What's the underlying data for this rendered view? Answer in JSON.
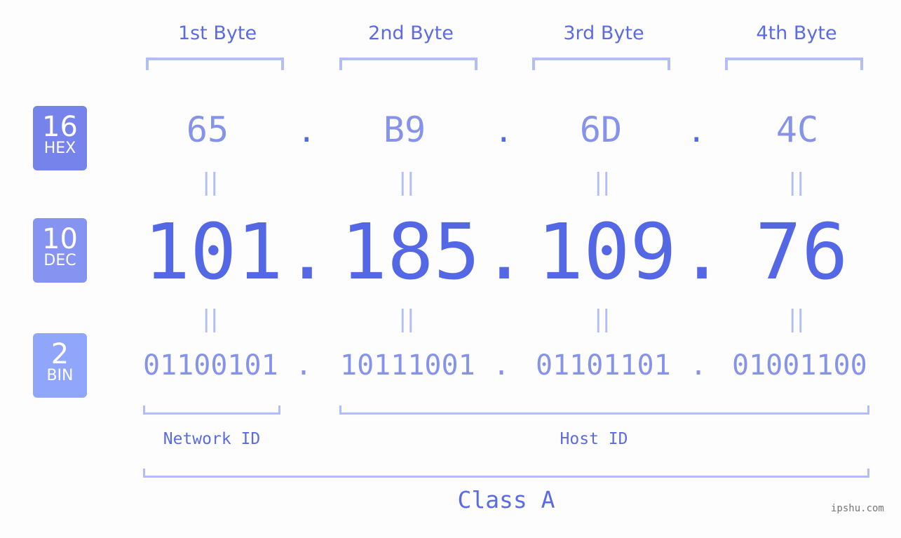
{
  "byte_headers": [
    "1st Byte",
    "2nd Byte",
    "3rd Byte",
    "4th Byte"
  ],
  "badges": {
    "hex": {
      "base": "16",
      "label": "HEX",
      "color": "#7683ea"
    },
    "dec": {
      "base": "10",
      "label": "DEC",
      "color": "#8693f0"
    },
    "bin": {
      "base": "2",
      "label": "BIN",
      "color": "#8fa6fa"
    }
  },
  "hex_values": [
    "65",
    "B9",
    "6D",
    "4C"
  ],
  "dec_values": [
    "101",
    "185",
    "109",
    "76"
  ],
  "bin_values": [
    "01100101",
    "10111001",
    "01101101",
    "01001100"
  ],
  "separator": ".",
  "equals_glyph": "||",
  "network_id_label": "Network ID",
  "host_id_label": "Host ID",
  "class_label": "Class A",
  "watermark": "ipshu.com"
}
